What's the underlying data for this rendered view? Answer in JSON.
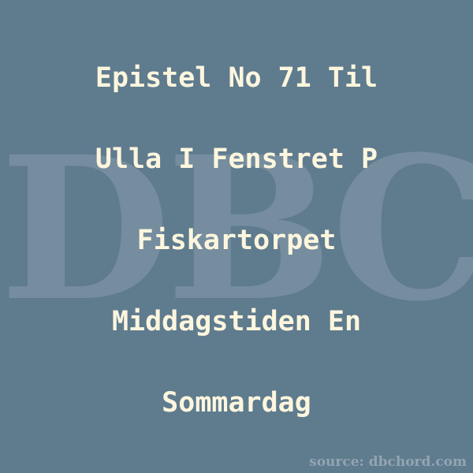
{
  "background_color": "#5f7b8e",
  "text_color": "#fdf6de",
  "watermark": {
    "text": "DBC"
  },
  "title": {
    "lines": [
      "Epistel No 71 Til",
      "Ulla I Fenstret P",
      "Fiskartorpet",
      "Middagstiden En",
      "Sommardag"
    ]
  },
  "source": {
    "text": "source: dbchord.com"
  }
}
